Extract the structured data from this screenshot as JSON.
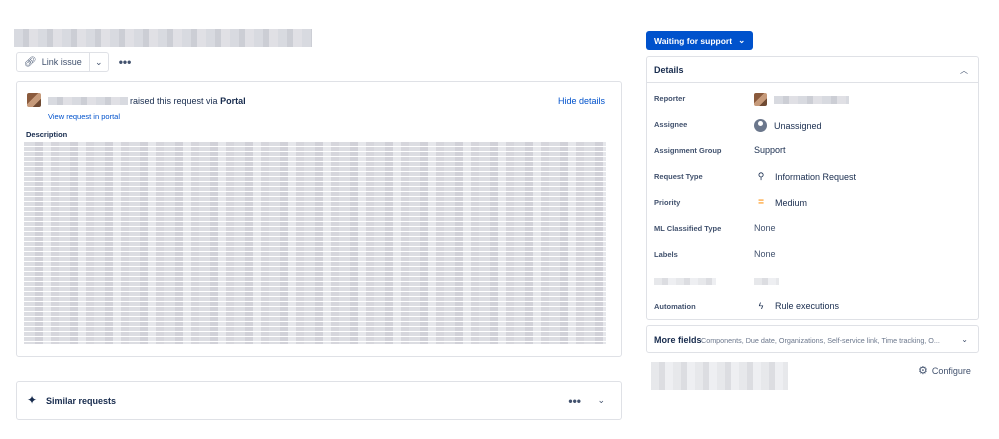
{
  "toolbar": {
    "link_issue_label": "Link issue",
    "link_icon": "link-icon",
    "dropdown_icon": "chevron-down-icon",
    "more_icon": "more-icon",
    "more_glyph": "•••",
    "chevron_glyph": "⌄"
  },
  "request": {
    "raised_text": "raised this request via",
    "channel": "Portal",
    "view_portal_link": "View request in portal",
    "hide_details_link": "Hide details",
    "description_label": "Description"
  },
  "similar": {
    "title": "Similar requests",
    "icon": "sparkle-icon"
  },
  "status": {
    "label": "Waiting for support",
    "color": "#0052cc"
  },
  "details": {
    "title": "Details",
    "rows": [
      {
        "label": "Reporter",
        "value": "",
        "icon": "avatar"
      },
      {
        "label": "Assignee",
        "value": "Unassigned",
        "icon": "unassigned-user-icon"
      },
      {
        "label": "Assignment Group",
        "value": "Support",
        "icon": ""
      },
      {
        "label": "Request Type",
        "value": "Information Request",
        "icon": "request-type-icon"
      },
      {
        "label": "Priority",
        "value": "Medium",
        "icon": "priority-medium-icon"
      },
      {
        "label": "ML Classified Type",
        "value": "None",
        "icon": ""
      },
      {
        "label": "Labels",
        "value": "None",
        "icon": ""
      },
      {
        "label": "",
        "value": "",
        "icon": ""
      },
      {
        "label": "Automation",
        "value": "Rule executions",
        "icon": "lightning-icon"
      }
    ]
  },
  "more_fields": {
    "title": "More fields",
    "summary": "Components, Due date, Organizations, Self-service link, Time tracking, O..."
  },
  "configure": {
    "label": "Configure",
    "icon": "gear-icon"
  },
  "colors": {
    "accent": "#0052cc",
    "priority_medium": "#ff991f",
    "text": "#172b4d",
    "border": "#dfe1e6"
  }
}
